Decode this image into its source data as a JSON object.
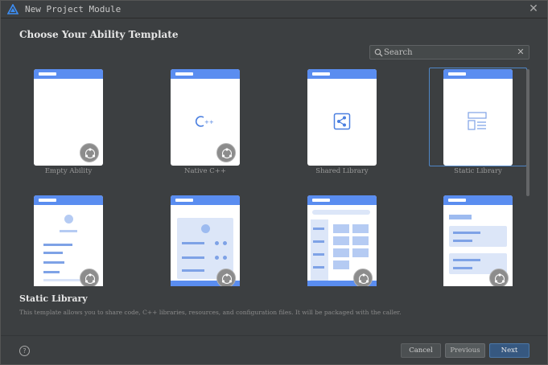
{
  "window": {
    "title": "New Project Module"
  },
  "heading": "Choose Your Ability Template",
  "search": {
    "placeholder": "Search"
  },
  "templates_row1": [
    {
      "label": "Empty Ability"
    },
    {
      "label": "Native C++"
    },
    {
      "label": "Shared Library"
    },
    {
      "label": "Static Library"
    }
  ],
  "selected_template": "Static Library",
  "description": {
    "title": "Static Library",
    "text": "This template allows you to share code, C++ libraries, resources, and configuration files. It will be packaged with the caller."
  },
  "footer": {
    "cancel_label": "Cancel",
    "previous_label": "Previous",
    "next_label": "Next"
  },
  "colors": {
    "accent": "#5a8df0",
    "selected_border": "#4f86c6",
    "next_button": "#365880"
  }
}
